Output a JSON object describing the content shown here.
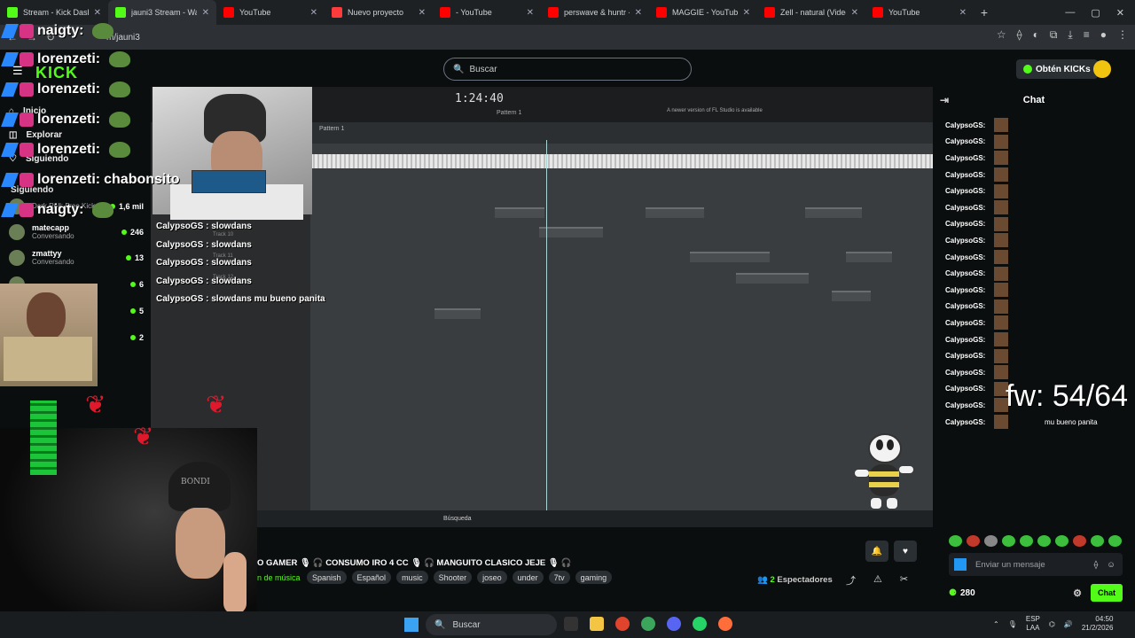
{
  "browser": {
    "tabs": [
      {
        "title": "Stream - Kick Dashb...",
        "color": "#53fc18"
      },
      {
        "title": "jauni3 Stream - Watc...",
        "color": "#53fc18"
      },
      {
        "title": "YouTube",
        "color": "#ff0000"
      },
      {
        "title": "Nuevo proyecto",
        "color": "#ff3b3b"
      },
      {
        "title": "- YouTube",
        "color": "#ff0000"
      },
      {
        "title": "perswave & huntr - L",
        "color": "#ff0000"
      },
      {
        "title": "MAGGIE - YouTube",
        "color": "#ff0000"
      },
      {
        "title": "Zell - natural (Video",
        "color": "#ff0000"
      },
      {
        "title": "YouTube",
        "color": "#ff0000"
      }
    ],
    "url": "m/jauni3"
  },
  "kick": {
    "search_placeholder": "Buscar",
    "kicks_button": "Obtén KICKs",
    "logo": "KICK",
    "nav": [
      {
        "label": "Inicio",
        "icon": "home-icon"
      },
      {
        "label": "Explorar",
        "icon": "compass-icon"
      },
      {
        "label": "Siguiendo",
        "icon": "heart-icon"
      }
    ],
    "following_title": "Siguiendo",
    "channels": [
      {
        "name": "",
        "sub": "Dark Roll: Free Kick...",
        "count": "1,6 mil"
      },
      {
        "name": "matecapp",
        "sub": "Conversando",
        "count": "246"
      },
      {
        "name": "zmattyy",
        "sub": "Conversando",
        "count": "13"
      },
      {
        "name": "",
        "sub": "",
        "count": "6"
      },
      {
        "name": "",
        "sub": "",
        "count": "5"
      },
      {
        "name": "",
        "sub": "ca",
        "count": "2"
      }
    ]
  },
  "overlay_chat": [
    {
      "user": "naigty:",
      "text": ""
    },
    {
      "user": "lorenzeti:",
      "text": ""
    },
    {
      "user": "lorenzeti:",
      "text": ""
    },
    {
      "user": "lorenzeti:",
      "text": ""
    },
    {
      "user": "lorenzeti:",
      "text": ""
    },
    {
      "user": "lorenzeti:",
      "text": "chabonsito"
    },
    {
      "user": "naigty:",
      "text": ""
    }
  ],
  "daw": {
    "time": "1:24:40",
    "pattern": "Pattern 1",
    "notice": "A newer version of FL Studio is available",
    "tracks": [
      "Track 9",
      "Track 10",
      "Track 11",
      "Track 12"
    ],
    "taskbar_search": "Búsqueda"
  },
  "stream_chat_overlay": [
    "CalypsoGS : slowdans",
    "CalypsoGS : slowdans",
    "CalypsoGS : slowdans",
    "CalypsoGS : slowdans",
    "CalypsoGS : slowdans mu bueno panita"
  ],
  "fw_counter": "fw: 54/64",
  "fw_sub": "mu bueno panita",
  "stream_info": {
    "title": "O GAMER 🎙 🎧 CONSUMO IRO 4 CC 🎙 🎧 MANGUITO CLASICO JEJE 🎙 🎧",
    "category": "n de música",
    "tags": [
      "Spanish",
      "Español",
      "music",
      "Shooter",
      "joseo",
      "under",
      "7tv",
      "gaming"
    ],
    "viewers_count": "2",
    "viewers_label": "Espectadores"
  },
  "chat": {
    "title": "Chat",
    "messages": [
      "CalypsoGS:",
      "CalypsoGS:",
      "CalypsoGS:",
      "CalypsoGS:",
      "CalypsoGS:",
      "CalypsoGS:",
      "CalypsoGS:",
      "CalypsoGS:",
      "CalypsoGS:",
      "CalypsoGS:",
      "CalypsoGS:",
      "CalypsoGS:",
      "CalypsoGS:",
      "CalypsoGS:",
      "CalypsoGS:",
      "CalypsoGS:",
      "CalypsoGS:",
      "CalypsoGS:",
      "CalypsoGS:"
    ],
    "input_placeholder": "Enviar un mensaje",
    "points": "280",
    "send_label": "Chat"
  },
  "webcam": {
    "cap_text": "BONDI"
  },
  "windows": {
    "search": "Buscar",
    "lang": "ESP",
    "lang_sub": "LAA",
    "time": "04:50",
    "date": "21/2/2026"
  }
}
